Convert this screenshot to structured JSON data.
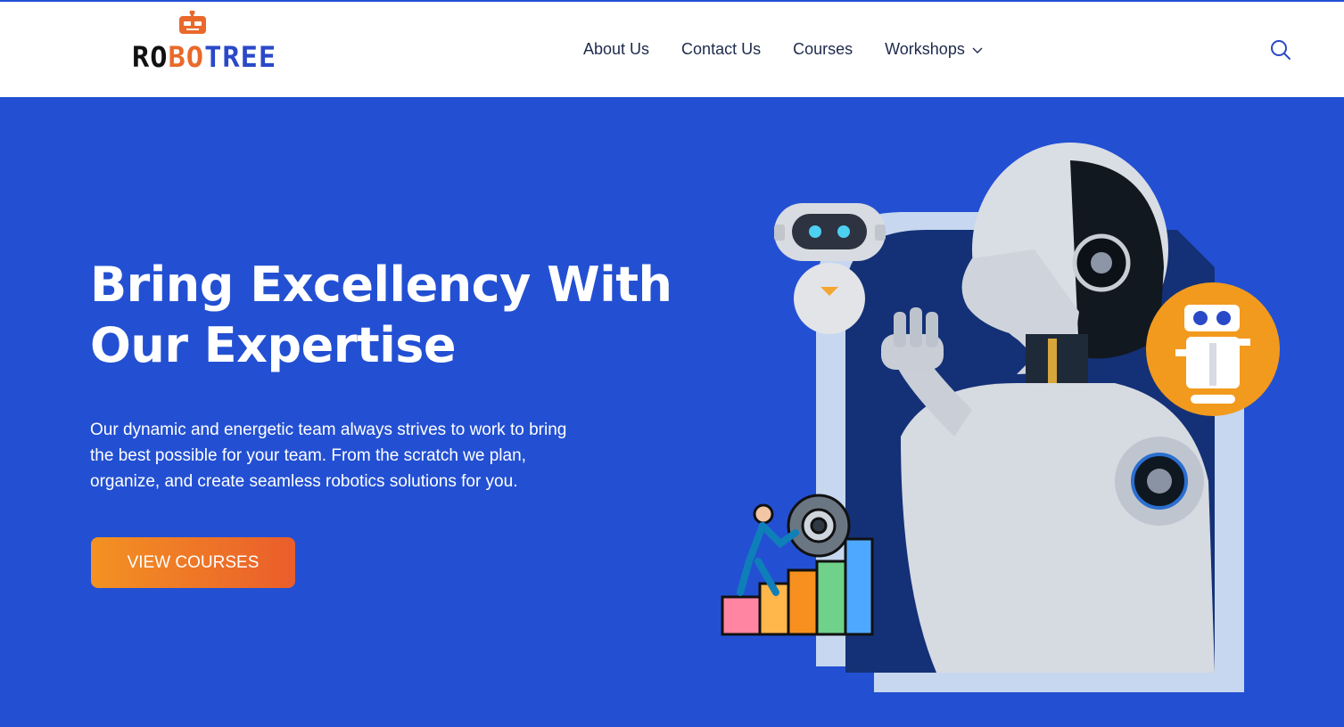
{
  "brand": {
    "logo_parts": [
      "RO",
      "BO",
      "TREE"
    ],
    "colors": {
      "accent_blue": "#2350d2",
      "accent_orange": "#e9692a",
      "dark_text": "#1d2a4b"
    }
  },
  "nav": {
    "items": [
      {
        "label": "About Us"
      },
      {
        "label": "Contact Us"
      },
      {
        "label": "Courses"
      },
      {
        "label": "Workshops",
        "icon": "chevron-down-icon"
      }
    ],
    "search_icon": "search-icon"
  },
  "hero": {
    "title_line1": "Bring Excellency With",
    "title_line2": "Our Expertise",
    "description": "Our dynamic and energetic team always strives to work to bring the best possible for your team. From the scratch we plan, organize, and create seamless robotics solutions for you.",
    "cta_label": "VIEW COURSES"
  }
}
